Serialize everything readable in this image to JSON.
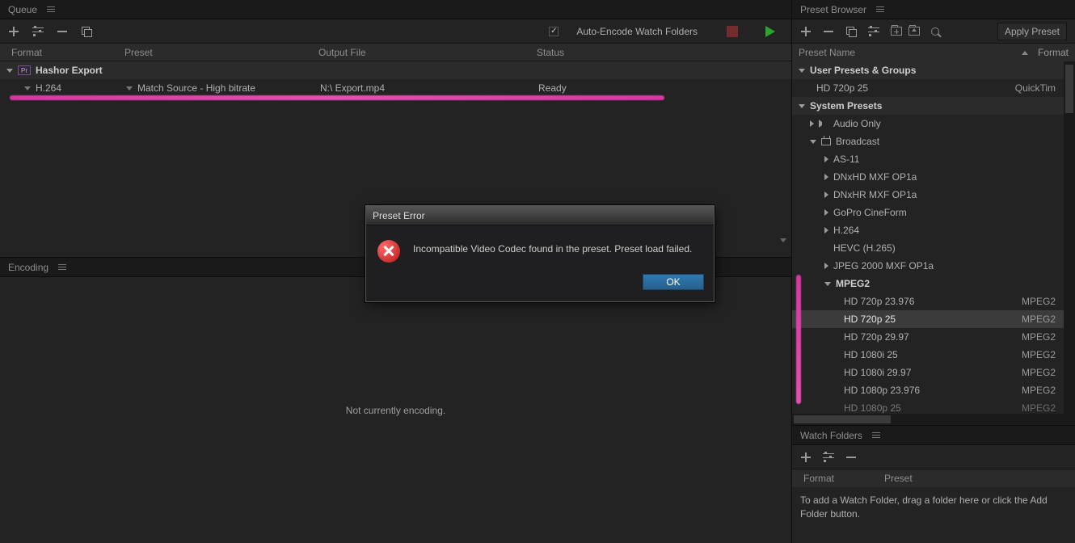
{
  "queue": {
    "tab": "Queue",
    "auto_encode_label": "Auto-Encode Watch Folders",
    "auto_encode_checked": true,
    "columns": {
      "format": "Format",
      "preset": "Preset",
      "output": "Output File",
      "status": "Status"
    },
    "group": {
      "badge": "Pr",
      "name": "Hashor Export"
    },
    "item": {
      "format": "H.264",
      "preset": "Match Source - High bitrate",
      "output": "N:\\  Export.mp4",
      "status": "Ready"
    }
  },
  "encoding": {
    "tab": "Encoding",
    "message": "Not currently encoding."
  },
  "preset_browser": {
    "tab": "Preset Browser",
    "apply": "Apply Preset",
    "head": {
      "name": "Preset Name",
      "format": "Format"
    },
    "user_group": "User Presets & Groups",
    "user_items": [
      {
        "name": "HD 720p 25",
        "format": "QuickTim"
      }
    ],
    "system_group": "System Presets",
    "audio_only": "Audio Only",
    "broadcast": "Broadcast",
    "broadcast_children": [
      "AS-11",
      "DNxHD MXF OP1a",
      "DNxHR MXF OP1a",
      "GoPro CineForm",
      "H.264",
      "HEVC (H.265)",
      "JPEG 2000 MXF OP1a"
    ],
    "mpeg2_label": "MPEG2",
    "mpeg2_items": [
      {
        "name": "HD 720p 23.976",
        "format": "MPEG2"
      },
      {
        "name": "HD 720p 25",
        "format": "MPEG2"
      },
      {
        "name": "HD 720p 29.97",
        "format": "MPEG2"
      },
      {
        "name": "HD 1080i 25",
        "format": "MPEG2"
      },
      {
        "name": "HD 1080i 29.97",
        "format": "MPEG2"
      },
      {
        "name": "HD 1080p 23.976",
        "format": "MPEG2"
      },
      {
        "name": "HD 1080p 25",
        "format": "MPEG2"
      }
    ],
    "selected_index": 1
  },
  "watch_folders": {
    "tab": "Watch Folders",
    "columns": {
      "format": "Format",
      "preset": "Preset"
    },
    "hint": "To add a Watch Folder, drag a folder here or click the Add Folder button."
  },
  "dialog": {
    "title": "Preset Error",
    "message": "Incompatible Video Codec found in the preset. Preset load failed.",
    "ok": "OK"
  },
  "colors": {
    "highlight_pink": "#e64fb2"
  }
}
